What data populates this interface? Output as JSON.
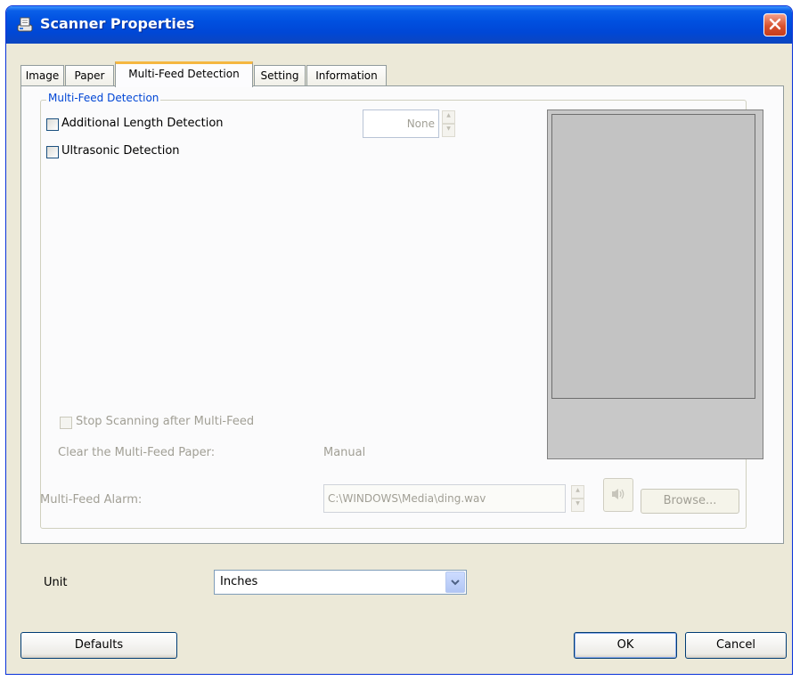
{
  "window": {
    "title": "Scanner Properties"
  },
  "tabs": [
    {
      "label": "Image"
    },
    {
      "label": "Paper"
    },
    {
      "label": "Multi-Feed Detection"
    },
    {
      "label": "Setting"
    },
    {
      "label": "Information"
    }
  ],
  "active_tab": "Multi-Feed Detection",
  "multifeed": {
    "group_label": "Multi-Feed Detection",
    "length_detection_label": "Additional Length Detection",
    "length_detection_checked": false,
    "length_value": "None",
    "ultrasonic_label": "Ultrasonic Detection",
    "ultrasonic_checked": false,
    "stop_scanning_label": "Stop Scanning after Multi-Feed",
    "stop_scanning_checked": false,
    "clear_paper_label": "Clear the Multi-Feed Paper:",
    "clear_paper_value": "Manual",
    "alarm_label": "Multi-Feed Alarm:",
    "alarm_path": "C:\\WINDOWS\\Media\\ding.wav",
    "browse_label": "Browse..."
  },
  "unit": {
    "label": "Unit",
    "value": "Inches"
  },
  "buttons": {
    "defaults": "Defaults",
    "ok": "OK",
    "cancel": "Cancel"
  },
  "icons": {
    "app": "scanner-icon",
    "close": "close-icon",
    "speaker": "speaker-icon",
    "dropdown": "chevron-down-icon"
  },
  "colors": {
    "titlebar": "#0050e0",
    "close_button": "#d6522f",
    "group_label": "#0046d5",
    "active_tab_accent": "#f5b741",
    "preview": "#c3c3c3"
  }
}
